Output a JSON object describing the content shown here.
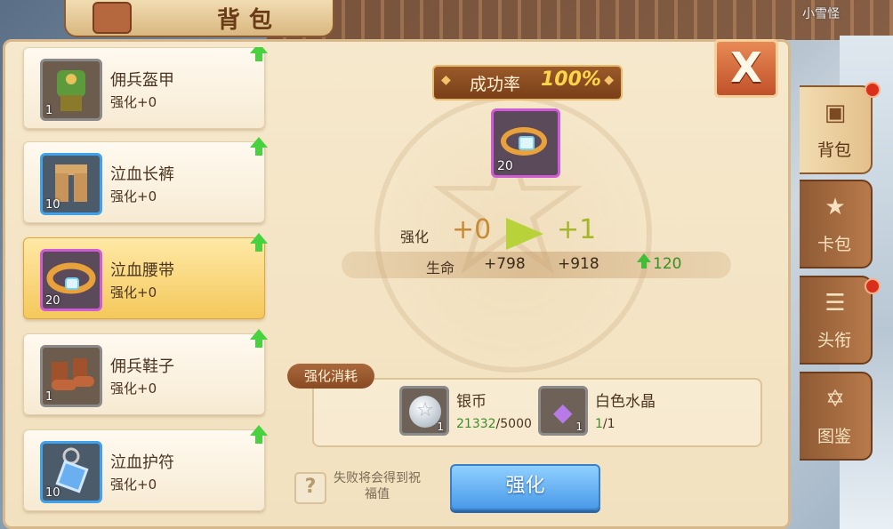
{
  "header": {
    "title": "背包",
    "player_name": "小雪怪"
  },
  "items": [
    {
      "name": "佣兵盔甲",
      "level": "强化+0",
      "count": "1",
      "rarity": "gray",
      "upgradable": true
    },
    {
      "name": "泣血长裤",
      "level": "强化+0",
      "count": "10",
      "rarity": "blue",
      "upgradable": true
    },
    {
      "name": "泣血腰带",
      "level": "强化+0",
      "count": "20",
      "rarity": "purple",
      "upgradable": true,
      "selected": true
    },
    {
      "name": "佣兵鞋子",
      "level": "强化+0",
      "count": "1",
      "rarity": "gray",
      "upgradable": true
    },
    {
      "name": "泣血护符",
      "level": "强化+0",
      "count": "10",
      "rarity": "blue",
      "upgradable": true
    }
  ],
  "main": {
    "rate_label": "成功率",
    "rate_value": "100%",
    "target_count": "20",
    "enhance_label": "强化",
    "enhance_from": "+0",
    "enhance_to": "+1",
    "stat": {
      "name": "生命",
      "current": "+798",
      "next": "+918",
      "diff": "120"
    },
    "cost_title": "强化消耗",
    "costs": [
      {
        "name": "银币",
        "have": "21332",
        "need": "/5000",
        "count": "1",
        "icon": "silver-coin-icon"
      },
      {
        "name": "白色水晶",
        "have": "1",
        "need": "/1",
        "count": "1",
        "icon": "crystal-icon"
      }
    ],
    "fail_note": "失败将会得到祝福值",
    "enhance_button": "强化",
    "close_label": "X"
  },
  "side_tabs": [
    {
      "label": "背包",
      "active": true,
      "icon": "bag-icon"
    },
    {
      "label": "卡包",
      "active": false,
      "icon": "card-pack-icon"
    },
    {
      "label": "头衔",
      "active": false,
      "icon": "scroll-icon"
    },
    {
      "label": "图鉴",
      "active": false,
      "icon": "star-book-icon"
    }
  ],
  "colors": {
    "accent_gold": "#ffd64a",
    "button_blue": "#4a9ae9",
    "upgrade_green": "#48d23f"
  }
}
